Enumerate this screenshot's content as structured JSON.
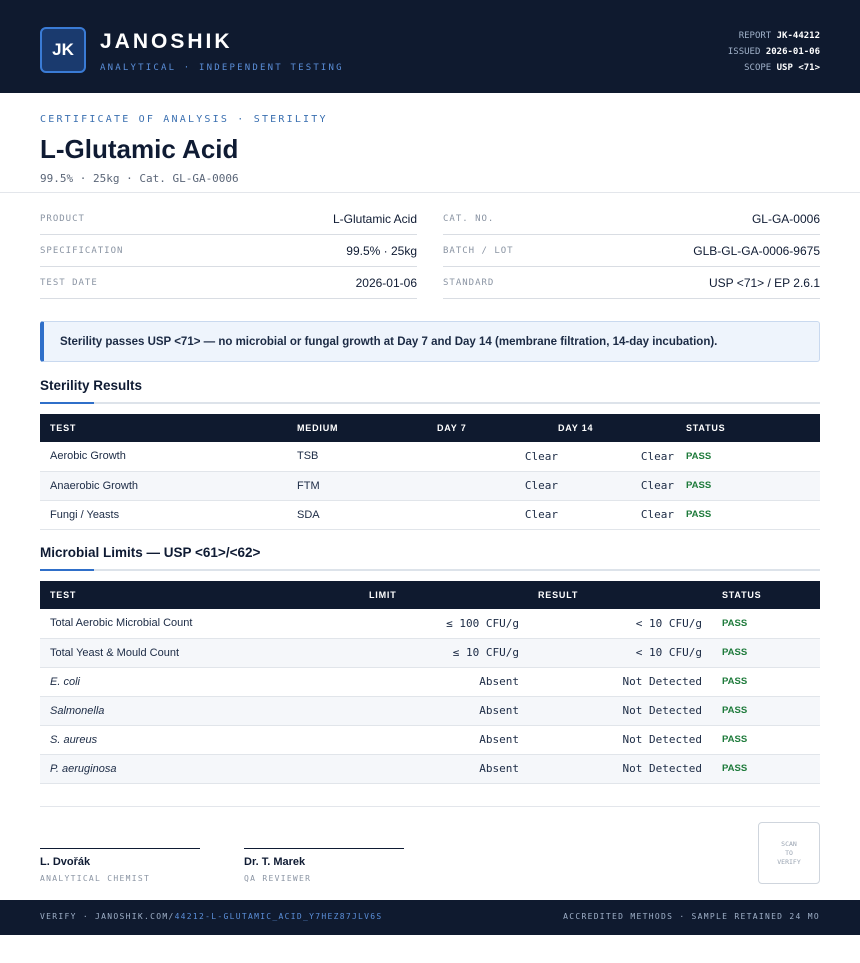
{
  "header": {
    "logo": "JK",
    "brand": "JANOSHIK",
    "tagline": "ANALYTICAL · INDEPENDENT TESTING",
    "report_label": "REPORT",
    "report_value": "JK-44212",
    "issued_label": "ISSUED",
    "issued_value": "2026-01-06",
    "scope_label": "SCOPE",
    "scope_value": "USP <71>"
  },
  "document": {
    "certificate_line": "CERTIFICATE OF ANALYSIS · STERILITY",
    "title": "L-Glutamic Acid",
    "subtitle": "99.5% · 25kg  ·  Cat. GL-GA-0006"
  },
  "info": {
    "left": [
      {
        "label": "PRODUCT",
        "value": "L-Glutamic Acid"
      },
      {
        "label": "SPECIFICATION",
        "value": "99.5% · 25kg"
      },
      {
        "label": "TEST DATE",
        "value": "2026-01-06"
      }
    ],
    "right": [
      {
        "label": "CAT. NO.",
        "value": "GL-GA-0006"
      },
      {
        "label": "BATCH / LOT",
        "value": "GLB-GL-GA-0006-9675"
      },
      {
        "label": "STANDARD",
        "value": "USP <71> / EP 2.6.1"
      }
    ]
  },
  "callout": "Sterility passes USP <71> — no microbial or fungal growth at Day 7 and Day 14 (membrane filtration, 14-day incubation).",
  "sterility": {
    "title": "Sterility Results",
    "headers": [
      "TEST",
      "MEDIUM",
      "DAY 7",
      "DAY 14",
      "STATUS"
    ],
    "rows": [
      {
        "test": "Aerobic Growth",
        "medium": "TSB",
        "day7": "Clear",
        "day14": "Clear",
        "status": "PASS"
      },
      {
        "test": "Anaerobic Growth",
        "medium": "FTM",
        "day7": "Clear",
        "day14": "Clear",
        "status": "PASS"
      },
      {
        "test": "Fungi / Yeasts",
        "medium": "SDA",
        "day7": "Clear",
        "day14": "Clear",
        "status": "PASS"
      }
    ]
  },
  "microbial": {
    "title": "Microbial Limits — USP <61>/<62>",
    "headers": [
      "TEST",
      "LIMIT",
      "RESULT",
      "STATUS"
    ],
    "rows": [
      {
        "test": "Total Aerobic Microbial Count",
        "limit": "≤ 100 CFU/g",
        "result": "< 10 CFU/g",
        "status": "PASS"
      },
      {
        "test": "Total Yeast & Mould Count",
        "limit": "≤ 10 CFU/g",
        "result": "< 10 CFU/g",
        "status": "PASS"
      },
      {
        "test": "E. coli",
        "limit": "Absent",
        "result": "Not Detected",
        "status": "PASS"
      },
      {
        "test": "Salmonella",
        "limit": "Absent",
        "result": "Not Detected",
        "status": "PASS"
      },
      {
        "test": "S. aureus",
        "limit": "Absent",
        "result": "Not Detected",
        "status": "PASS"
      },
      {
        "test": "P. aeruginosa",
        "limit": "Absent",
        "result": "Not Detected",
        "status": "PASS"
      }
    ]
  },
  "signatures": [
    {
      "name": "L. Dvořák",
      "role": "ANALYTICAL CHEMIST"
    },
    {
      "name": "Dr. T. Marek",
      "role": "QA REVIEWER"
    }
  ],
  "qr": {
    "line1": "SCAN",
    "line2": "TO",
    "line3": "VERIFY"
  },
  "footer": {
    "verify_prefix": "VERIFY · JANOSHIK.COM/",
    "verify_link": "44212-L-GLUTAMIC_ACID_Y7HEZ87JLV6S",
    "right": "ACCREDITED METHODS · SAMPLE RETAINED 24 MO"
  },
  "colors": {
    "navy": "#0f1a2f",
    "accent": "#2f6fc9",
    "pass": "#1d7a3a"
  }
}
